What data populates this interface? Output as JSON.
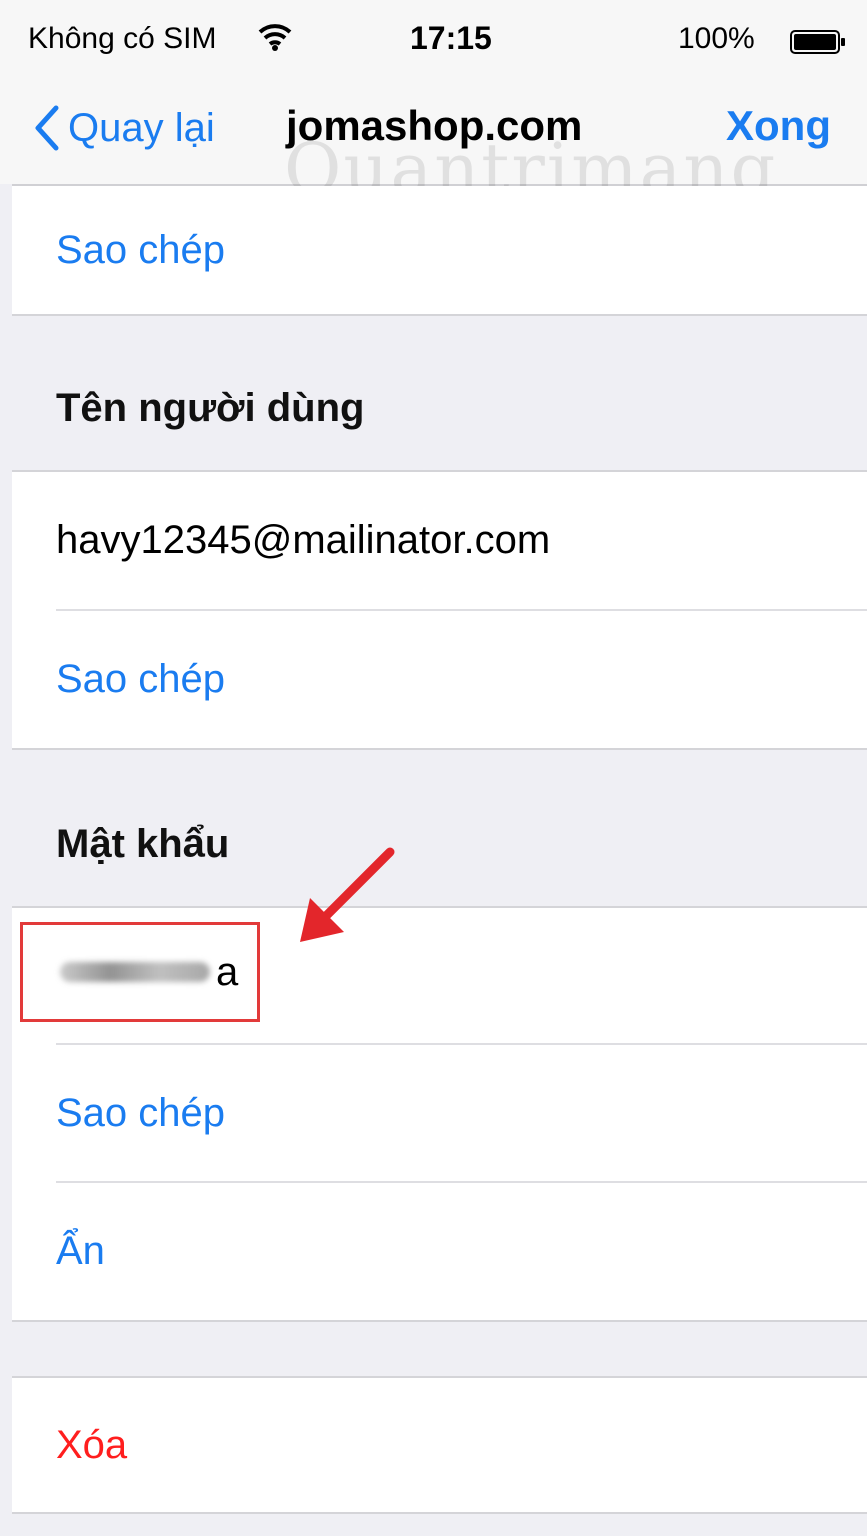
{
  "status_bar": {
    "carrier": "Không có SIM",
    "time": "17:15",
    "battery_percent": "100%"
  },
  "nav": {
    "back_label": "Quay lại",
    "title": "jomashop.com",
    "done_label": "Xong"
  },
  "watermark": "Quantrimang",
  "sections": {
    "website": {
      "copy_label": "Sao chép"
    },
    "username": {
      "header": "Tên người dùng",
      "value": "havy12345@mailinator.com",
      "copy_label": "Sao chép"
    },
    "password": {
      "header": "Mật khẩu",
      "visible_last_char": "a",
      "copy_label": "Sao chép",
      "hide_label": "Ẩn"
    },
    "delete": {
      "label": "Xóa"
    }
  },
  "colors": {
    "accent": "#1a7cf0",
    "destructive": "#ff1e1e",
    "highlight_box": "#e23a3a",
    "background": "#efeff4"
  },
  "icons": [
    "wifi-icon",
    "battery-icon",
    "back-chevron-icon",
    "red-arrow-icon"
  ]
}
